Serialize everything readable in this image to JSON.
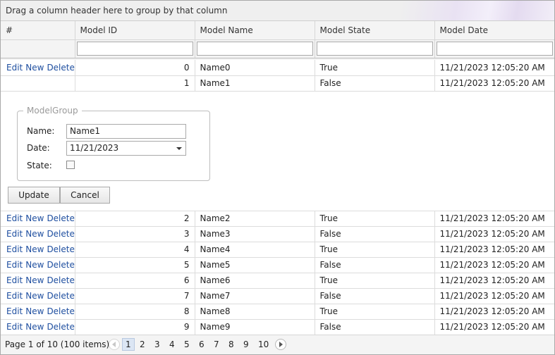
{
  "group_panel": {
    "text": "Drag a column header here to group by that column"
  },
  "columns": [
    "#",
    "Model ID",
    "Model Name",
    "Model State",
    "Model Date"
  ],
  "commands": {
    "edit": "Edit",
    "new": "New",
    "delete": "Delete"
  },
  "rows": [
    {
      "id": "0",
      "name": "Name0",
      "state": "True",
      "date": "11/21/2023 12:05:20 AM"
    },
    {
      "id": "1",
      "name": "Name1",
      "state": "False",
      "date": "11/21/2023 12:05:20 AM"
    },
    {
      "id": "2",
      "name": "Name2",
      "state": "True",
      "date": "11/21/2023 12:05:20 AM"
    },
    {
      "id": "3",
      "name": "Name3",
      "state": "False",
      "date": "11/21/2023 12:05:20 AM"
    },
    {
      "id": "4",
      "name": "Name4",
      "state": "True",
      "date": "11/21/2023 12:05:20 AM"
    },
    {
      "id": "5",
      "name": "Name5",
      "state": "False",
      "date": "11/21/2023 12:05:20 AM"
    },
    {
      "id": "6",
      "name": "Name6",
      "state": "True",
      "date": "11/21/2023 12:05:20 AM"
    },
    {
      "id": "7",
      "name": "Name7",
      "state": "False",
      "date": "11/21/2023 12:05:20 AM"
    },
    {
      "id": "8",
      "name": "Name8",
      "state": "True",
      "date": "11/21/2023 12:05:20 AM"
    },
    {
      "id": "9",
      "name": "Name9",
      "state": "False",
      "date": "11/21/2023 12:05:20 AM"
    }
  ],
  "edit_form": {
    "legend": "ModelGroup",
    "name_label": "Name:",
    "name_value": "Name1",
    "date_label": "Date:",
    "date_value": "11/21/2023",
    "state_label": "State:",
    "state_checked": false,
    "update_label": "Update",
    "cancel_label": "Cancel"
  },
  "pager": {
    "info": "Page 1 of 10 (100 items)",
    "pages": [
      "1",
      "2",
      "3",
      "4",
      "5",
      "6",
      "7",
      "8",
      "9",
      "10"
    ],
    "current_page": "1"
  },
  "colors": {
    "link": "#1f4fa0",
    "header_bg": "#f4f4f4",
    "current_page_bg": "#dce6f4"
  }
}
